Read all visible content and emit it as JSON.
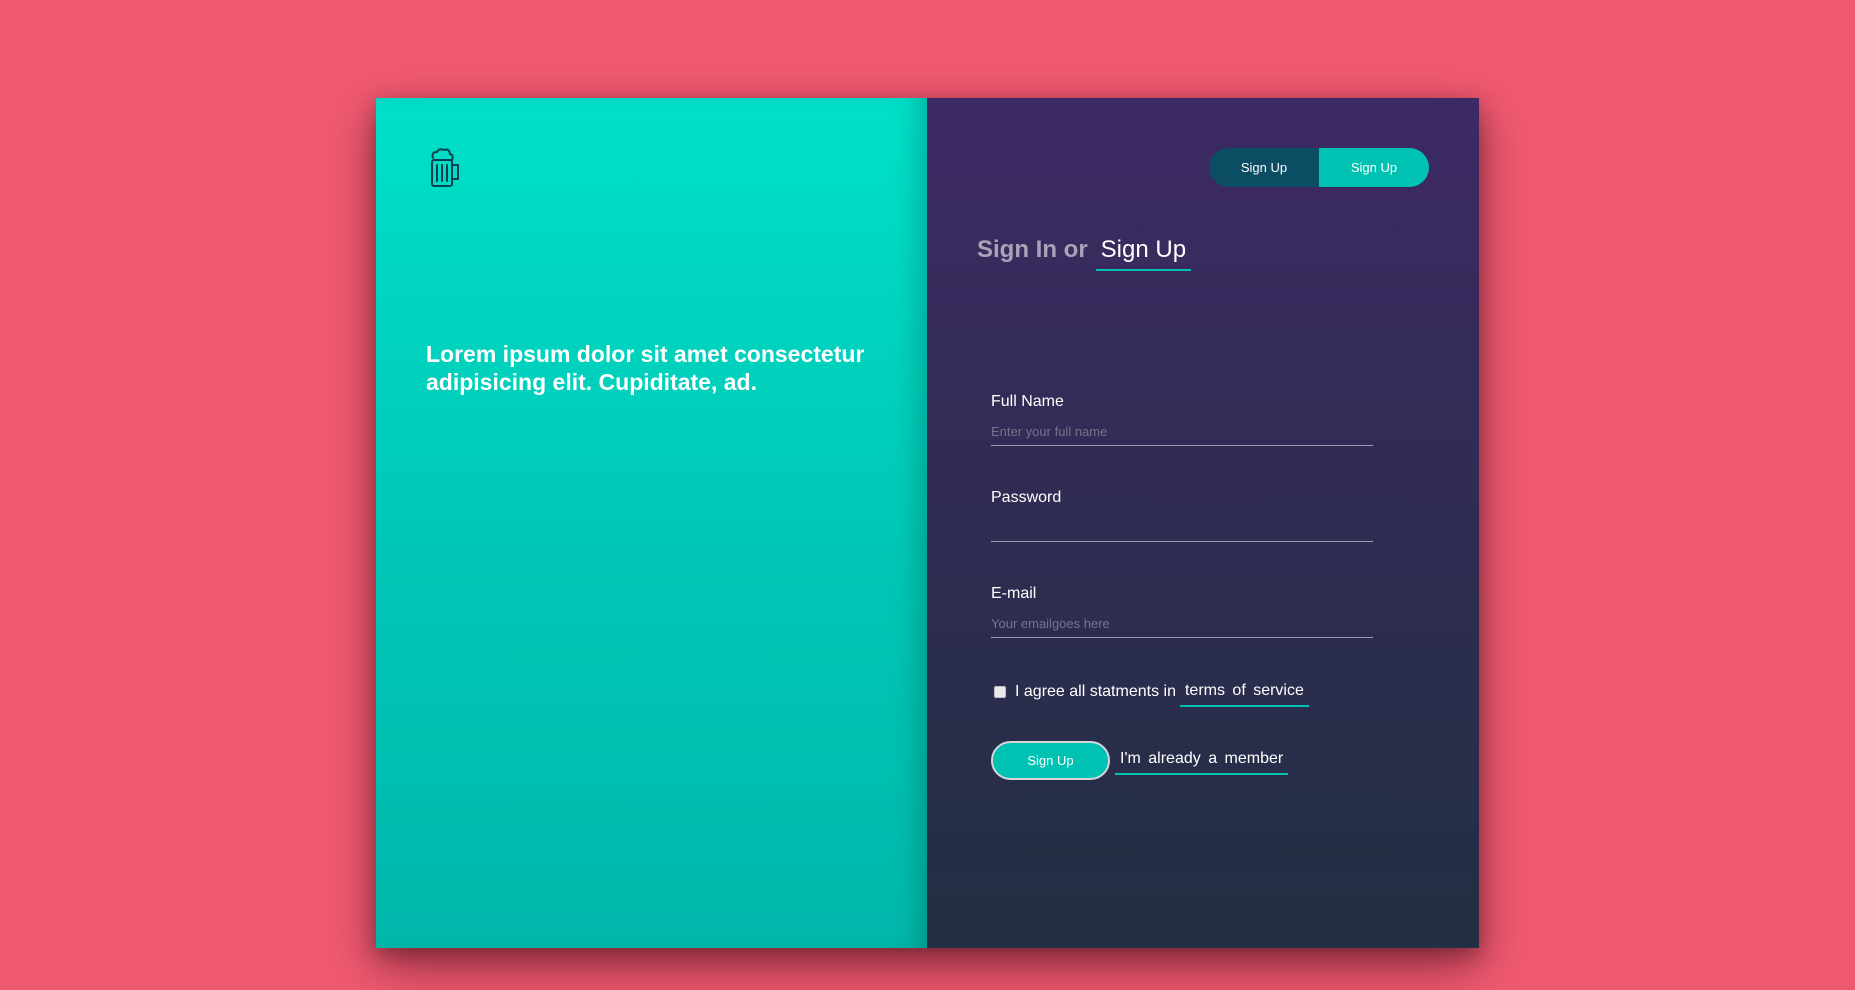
{
  "left_panel": {
    "logo_icon": "beer-mug-icon",
    "tagline": "Lorem ipsum dolor sit amet consectetur adipisicing elit. Cupiditate, ad."
  },
  "switcher": {
    "left_label": "Sign Up",
    "right_label": "Sign Up"
  },
  "heading": {
    "sign_in": "Sign In or",
    "sign_up": "Sign Up"
  },
  "form": {
    "full_name": {
      "label": "Full Name",
      "placeholder": "Enter your full name",
      "value": ""
    },
    "password": {
      "label": "Password",
      "placeholder": "",
      "value": ""
    },
    "email": {
      "label": "E-mail",
      "placeholder": "Your emailgoes here",
      "value": ""
    },
    "agree_text": "I agree all statments in",
    "terms_link": "terms of service",
    "agree_checked": false,
    "submit_label": "Sign Up",
    "member_link": "I'm already a member"
  },
  "colors": {
    "page_background": "#f05a71",
    "accent": "#00c2b2",
    "left_panel": "#00d5c0",
    "right_panel": "#302c54",
    "switcher_dark": "#0b4d63"
  }
}
